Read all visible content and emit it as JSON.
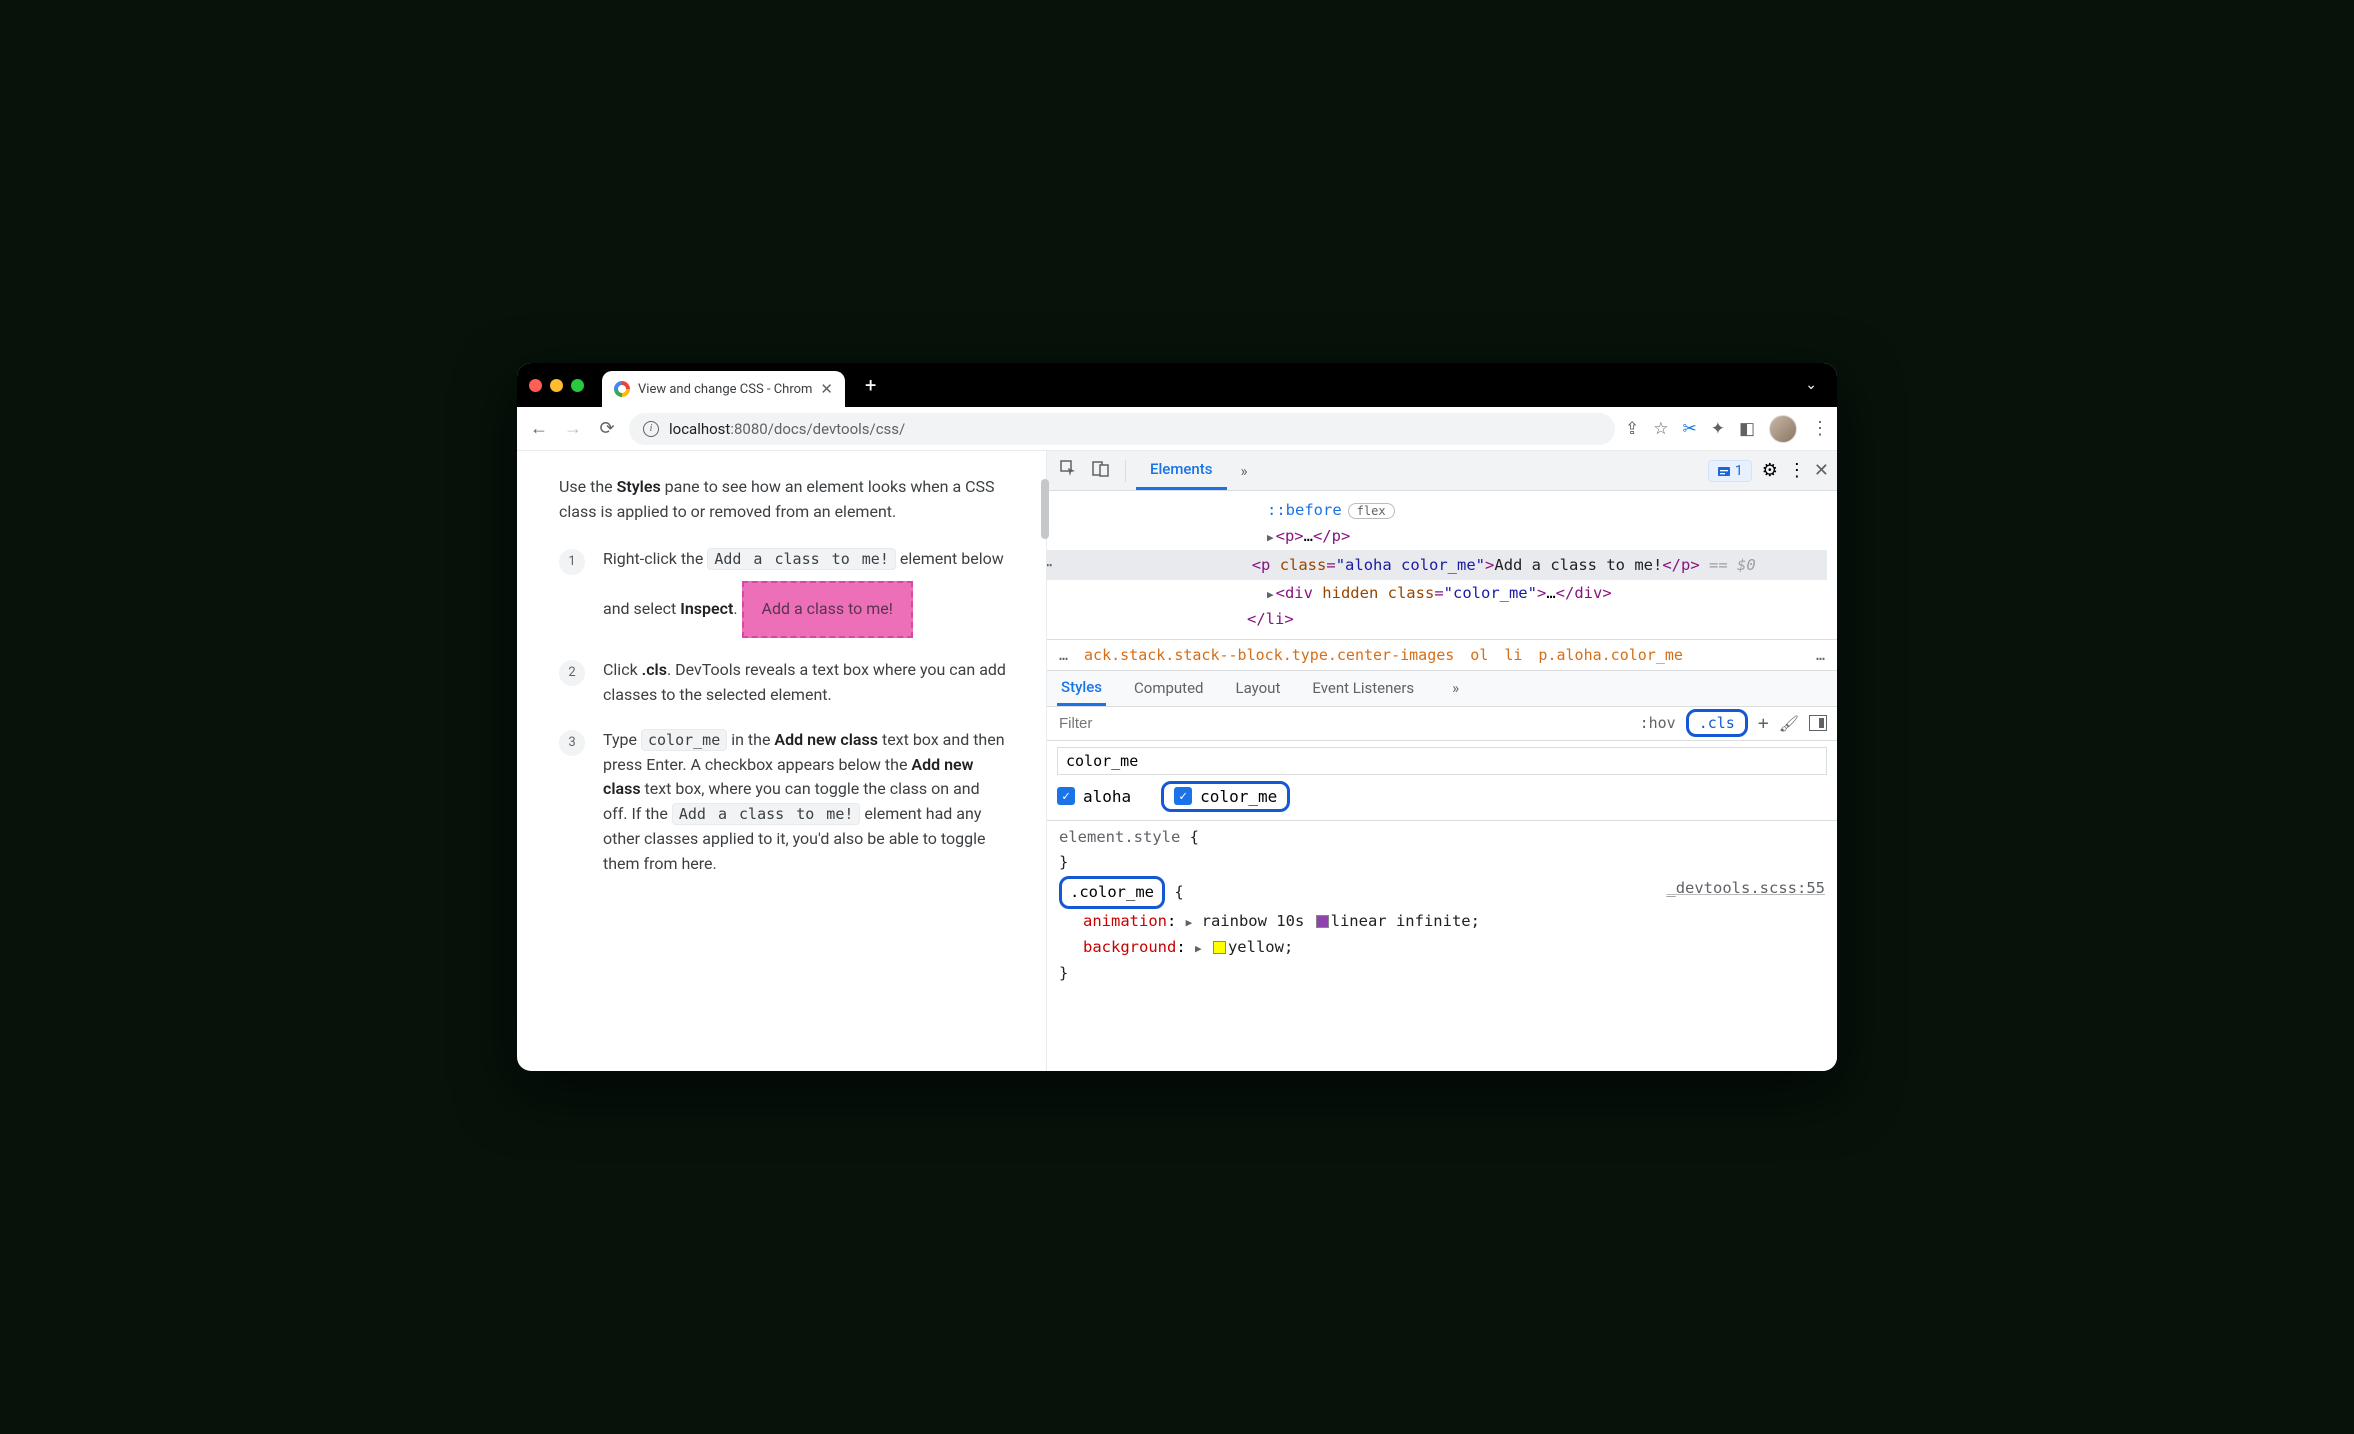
{
  "browser": {
    "tab_title": "View and change CSS - Chrom",
    "url_prefix": "localhost",
    "url_port": ":8080",
    "url_path": "/docs/devtools/css/"
  },
  "page": {
    "intro_1": "Use the ",
    "intro_b1": "Styles",
    "intro_2": " pane to see how an element looks when a CSS class is applied to or removed from an element.",
    "s1_a": "Right-click the ",
    "s1_code": "Add a class to me!",
    "s1_b": " element below and select ",
    "s1_bold": "Inspect",
    "s1_c": ".",
    "demo": "Add a class to me!",
    "s2_a": "Click ",
    "s2_bold": ".cls",
    "s2_b": ". DevTools reveals a text box where you can add classes to the selected element.",
    "s3_a": "Type ",
    "s3_code1": "color_me",
    "s3_b": " in the ",
    "s3_bold1": "Add new class",
    "s3_c": " text box and then press Enter. A checkbox appears below the ",
    "s3_bold2": "Add new class",
    "s3_d": " text box, where you can toggle the class on and off. If the ",
    "s3_code2": "Add a class to me!",
    "s3_e": " element had any other classes applied to it, you'd also be able to toggle them from here."
  },
  "devtools": {
    "elements": "Elements",
    "issues_count": "1",
    "crumb1": "ack.stack.stack--block.type.center-images",
    "crumb2": "ol",
    "crumb3": "li",
    "crumb4": "p.aloha.color_me",
    "subtabs": {
      "styles": "Styles",
      "computed": "Computed",
      "layout": "Layout",
      "listeners": "Event Listeners"
    },
    "filter_placeholder": "Filter",
    "hov": ":hov",
    "cls": ".cls",
    "class_input_value": "color_me",
    "chk_aloha": "aloha",
    "chk_colorme": "color_me",
    "elstyle": "element.style",
    "rule_selector": ".color_me",
    "rule_source": "_devtools.scss:55",
    "prop_anim_name": "animation",
    "prop_anim_val": " rainbow 10s ",
    "prop_anim_val2": "linear infinite;",
    "prop_bg_name": "background",
    "prop_bg_val": "yellow;"
  },
  "dom": {
    "before": "::before",
    "flex": "flex",
    "p_open": "<p>",
    "dots": "…",
    "p_close": "</p>",
    "sel_open": "<p ",
    "sel_class_attr": "class",
    "sel_class_val": "\"aloha color_me\"",
    "sel_gt": ">",
    "sel_text": "Add a class to me!",
    "sel_close": "</p>",
    "eq0": " == $0",
    "div_open": "<div ",
    "hidden": "hidden",
    "div_class_val": "\"color_me\"",
    "div_close": "</div>",
    "li_close": "</li>"
  }
}
